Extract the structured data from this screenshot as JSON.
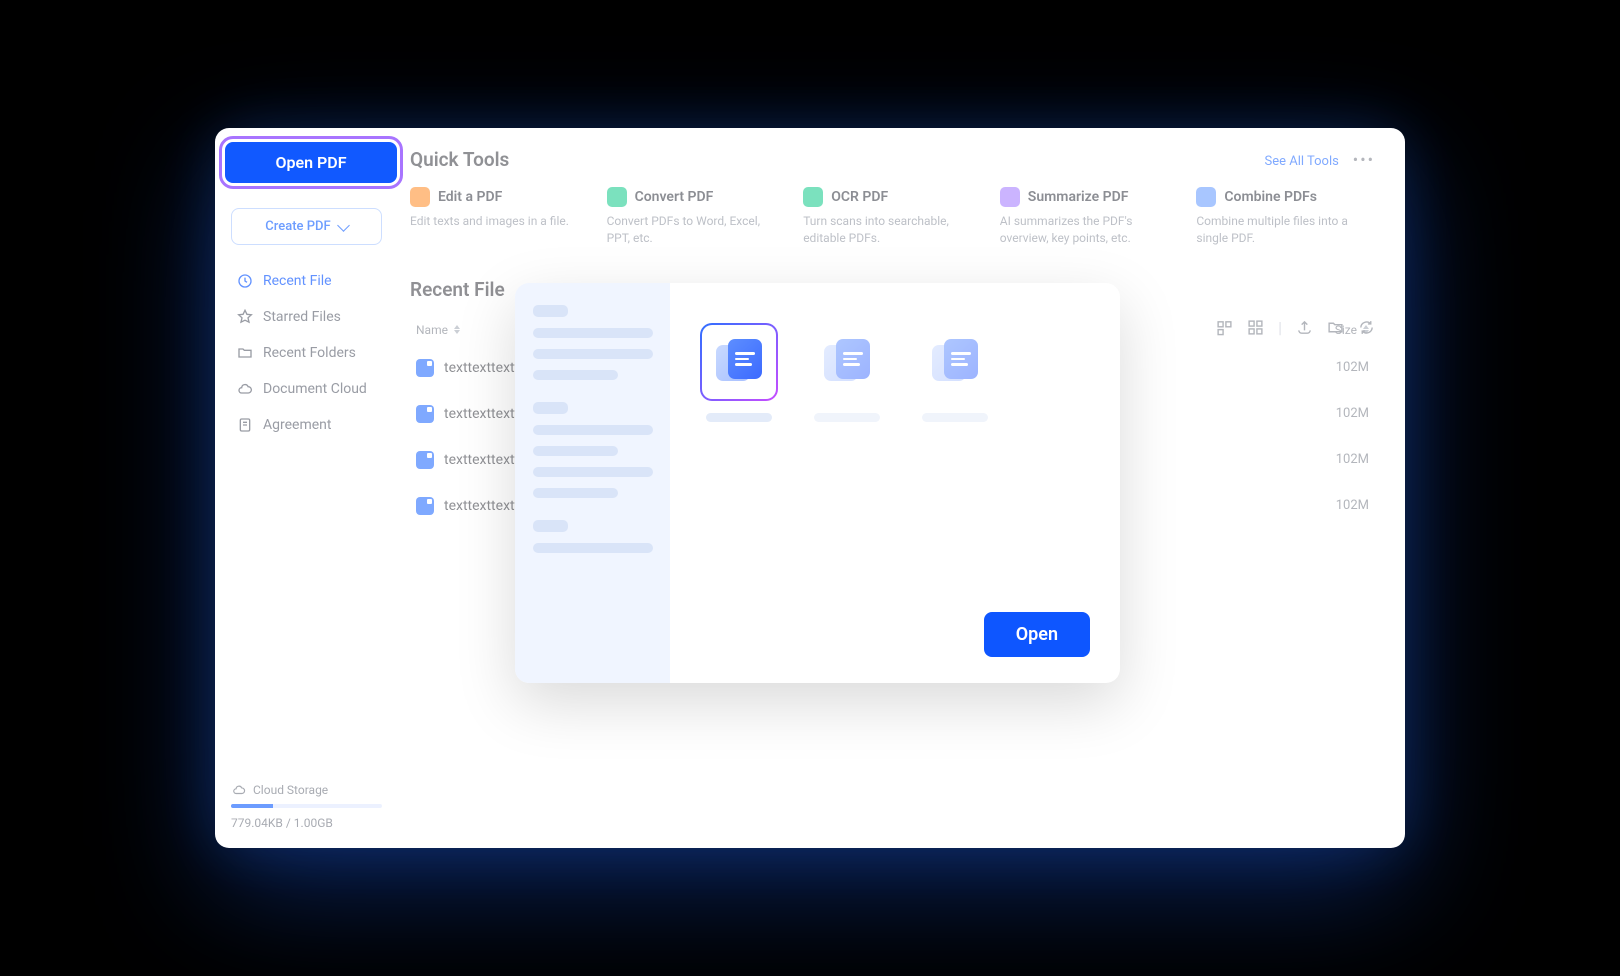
{
  "sidebar": {
    "open_pdf": "Open PDF",
    "create_pdf": "Create PDF",
    "nav": [
      {
        "label": "Recent File",
        "active": true
      },
      {
        "label": "Starred Files",
        "active": false
      },
      {
        "label": "Recent Folders",
        "active": false
      },
      {
        "label": "Document Cloud",
        "active": false
      },
      {
        "label": "Agreement",
        "active": false
      }
    ],
    "storage_label": "Cloud Storage",
    "storage_text": "779.04KB / 1.00GB"
  },
  "tools": {
    "title": "Quick Tools",
    "see_all": "See All Tools",
    "items": [
      {
        "title": "Edit a PDF",
        "desc": "Edit texts and images in a file.",
        "color": "#ff9b44"
      },
      {
        "title": "Convert PDF",
        "desc": "Convert PDFs to Word, Excel, PPT, etc.",
        "color": "#35d19b"
      },
      {
        "title": "OCR PDF",
        "desc": "Turn scans into searchable, editable PDFs.",
        "color": "#35d19b"
      },
      {
        "title": "Summarize PDF",
        "desc": "AI summarizes the PDF's overview, key points, etc.",
        "color": "#b08cff"
      },
      {
        "title": "Combine PDFs",
        "desc": "Combine multiple files into a single PDF.",
        "color": "#7aa8ff"
      }
    ]
  },
  "recent": {
    "title": "Recent File",
    "col_name": "Name",
    "col_size": "Size",
    "rows": [
      {
        "name": "texttexttexttex",
        "size": "102M"
      },
      {
        "name": "texttexttexttex",
        "size": "102M"
      },
      {
        "name": "texttexttexttex",
        "size": "102M"
      },
      {
        "name": "texttexttexttex",
        "size": "102M"
      }
    ]
  },
  "dialog": {
    "open": "Open"
  }
}
